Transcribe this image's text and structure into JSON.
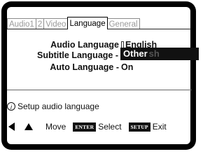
{
  "tabs": [
    {
      "label": "Audio1",
      "active": false
    },
    {
      "label": "2",
      "active": false
    },
    {
      "label": "Video",
      "active": false
    },
    {
      "label": "Language",
      "active": true
    },
    {
      "label": "General",
      "active": false
    }
  ],
  "settings": [
    {
      "label": "Audio Language",
      "value": "English"
    },
    {
      "label": "Subtitle Language -",
      "value": "Other"
    },
    {
      "label": "Auto Language -",
      "value": "On"
    }
  ],
  "popup": {
    "selected": "Other",
    "ghost": "sh"
  },
  "help_text": "Setup audio language",
  "footer": {
    "move_label": "Move",
    "enter_key": "ENTER",
    "select_label": "Select",
    "setup_key": "SETUP",
    "exit_label": "Exit"
  },
  "colors": {
    "background": "#000000",
    "panel": "#ffffff",
    "highlight": "#111111"
  }
}
